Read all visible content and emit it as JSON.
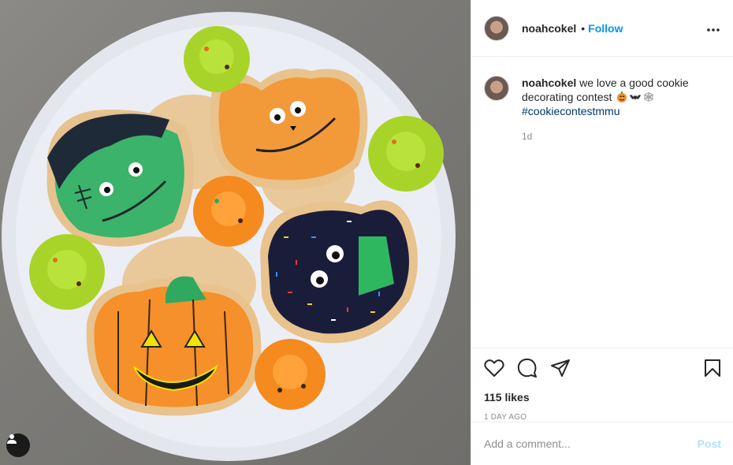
{
  "post": {
    "username": "noahcokel",
    "follow_separator": "•",
    "follow_label": "Follow",
    "more_icon": "more-horizontal-icon",
    "caption": {
      "username": "noahcokel",
      "text": " we love a good cookie decorating contest ",
      "emojis": [
        "jack-o-lantern",
        "bat",
        "spider-web"
      ],
      "hashtag": "#cookiecontestmmu"
    },
    "time_ago": "1d",
    "likes": "115 likes",
    "date": "1 DAY AGO",
    "comment_placeholder": "Add a comment...",
    "post_label": "Post"
  },
  "photo": {
    "description_tag": "user-tag-icon"
  },
  "colors": {
    "accent": "#0095f6",
    "hashtag": "#00376b",
    "muted": "#8e8e8e",
    "post_disabled": "#b2dffc"
  }
}
